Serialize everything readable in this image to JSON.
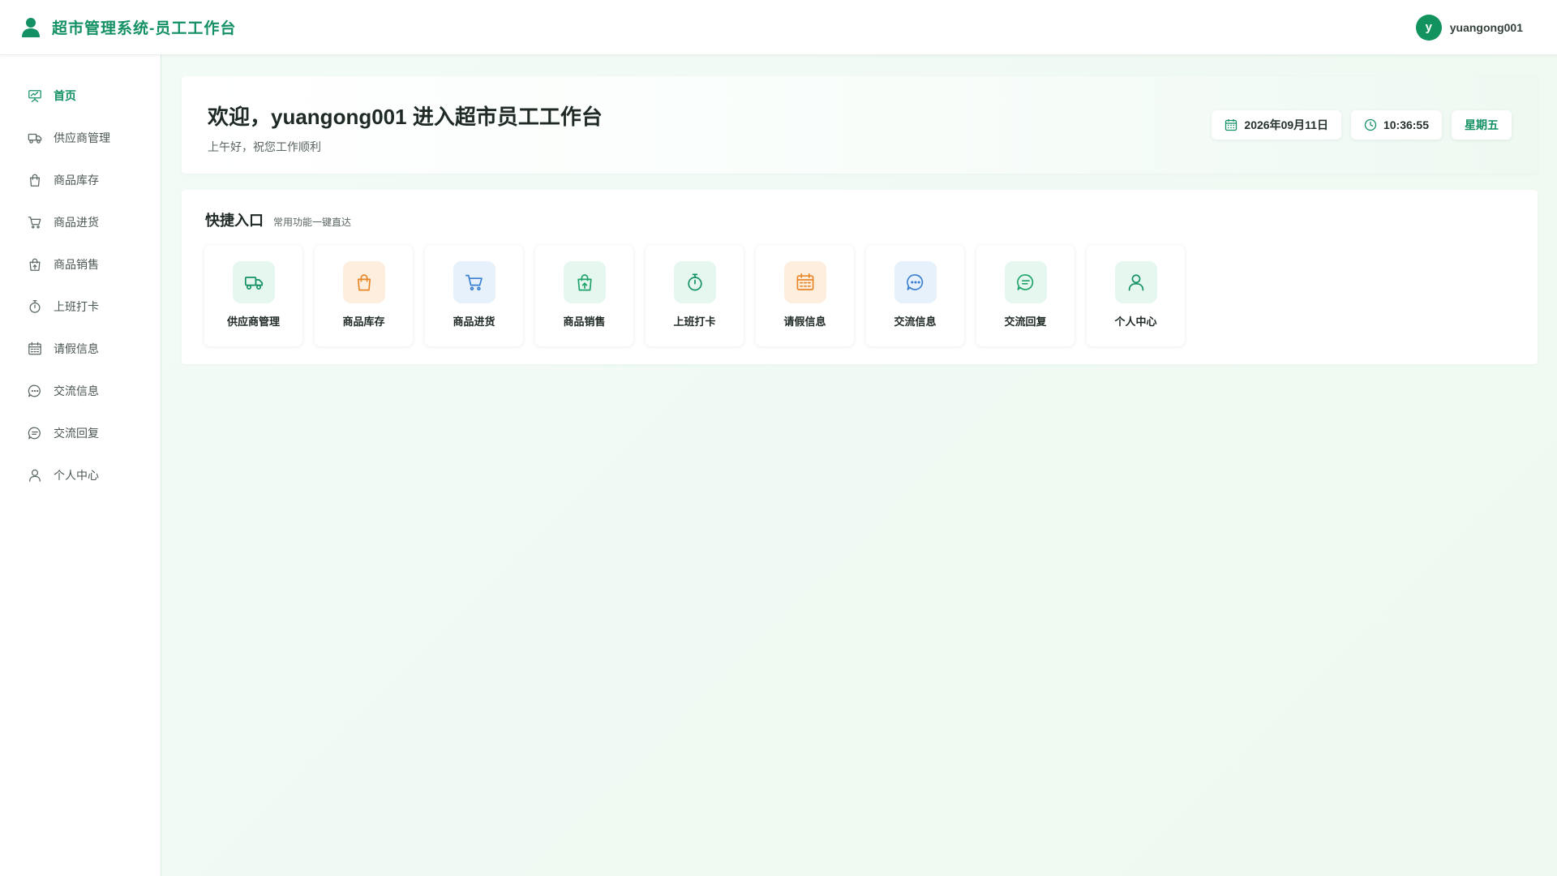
{
  "header": {
    "title": "超市管理系统-员工工作台",
    "brand_icon": "user-icon",
    "user": {
      "avatar_letter": "y",
      "name": "yuangong001"
    }
  },
  "sidebar": {
    "items": [
      {
        "label": "首页",
        "icon": "presentation-chart-icon",
        "active": true
      },
      {
        "label": "供应商管理",
        "icon": "truck-icon"
      },
      {
        "label": "商品库存",
        "icon": "shopping-bag-icon"
      },
      {
        "label": "商品进货",
        "icon": "cart-icon"
      },
      {
        "label": "商品销售",
        "icon": "bag-upload-icon"
      },
      {
        "label": "上班打卡",
        "icon": "stopwatch-icon"
      },
      {
        "label": "请假信息",
        "icon": "calendar-icon"
      },
      {
        "label": "交流信息",
        "icon": "chat-dots-icon"
      },
      {
        "label": "交流回复",
        "icon": "chat-lines-icon"
      },
      {
        "label": "个人中心",
        "icon": "person-icon"
      }
    ]
  },
  "welcome": {
    "title": "欢迎，yuangong001 进入超市员工工作台",
    "subtitle": "上午好，祝您工作顺利",
    "date": "2026年09月11日",
    "time": "10:36:55",
    "weekday": "星期五"
  },
  "quick": {
    "title": "快捷入口",
    "subtitle": "常用功能一键直达",
    "tiles": [
      {
        "label": "供应商管理",
        "icon": "truck-icon",
        "bg": "#e6f7ef",
        "color": "#149164"
      },
      {
        "label": "商品库存",
        "icon": "shopping-bag-icon",
        "bg": "#fdeedd",
        "color": "#e8862a"
      },
      {
        "label": "商品进货",
        "icon": "cart-icon",
        "bg": "#e6f1fb",
        "color": "#3a7fd0"
      },
      {
        "label": "商品销售",
        "icon": "bag-upload-icon",
        "bg": "#e6f7ef",
        "color": "#1ea36b"
      },
      {
        "label": "上班打卡",
        "icon": "stopwatch-icon",
        "bg": "#e6f7ef",
        "color": "#149164"
      },
      {
        "label": "请假信息",
        "icon": "calendar-icon",
        "bg": "#fdeedd",
        "color": "#e8862a"
      },
      {
        "label": "交流信息",
        "icon": "chat-dots-icon",
        "bg": "#e6f1fb",
        "color": "#3a7fd0"
      },
      {
        "label": "交流回复",
        "icon": "chat-lines-icon",
        "bg": "#e6f7ef",
        "color": "#1ea36b"
      },
      {
        "label": "个人中心",
        "icon": "person-icon",
        "bg": "#e6f7ef",
        "color": "#149164"
      }
    ]
  },
  "colors": {
    "accent": "#149164",
    "sidebar_icon": "#5b6862",
    "chip_icon": "#149164"
  }
}
